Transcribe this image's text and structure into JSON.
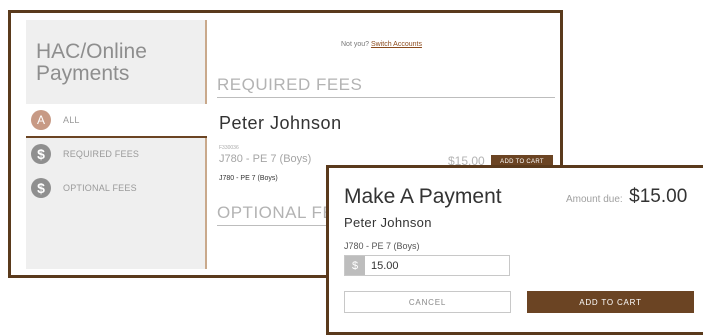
{
  "portal": {
    "title": "HAC/Online Payments",
    "nav": [
      {
        "icon": "A",
        "label": "ALL"
      },
      {
        "icon": "$",
        "label": "REQUIRED FEES"
      },
      {
        "icon": "$",
        "label": "OPTIONAL FEES"
      }
    ],
    "not_you_text": "Not you?",
    "switch_accounts_link": "Switch Accounts",
    "required_heading": "REQUIRED FEES",
    "optional_heading": "OPTIONAL FEES",
    "student_name": "Peter Johnson",
    "fee": {
      "id": "F330036",
      "name": "J780 - PE 7 (Boys)",
      "sub": "J780 - PE 7 (Boys)",
      "amount": "$15.00",
      "add_label": "ADD TO CART"
    }
  },
  "modal": {
    "title": "Make A Payment",
    "amount_due_label": "Amount due:",
    "amount_due_value": "$15.00",
    "student_name": "Peter Johnson",
    "fee_name": "J780 - PE 7 (Boys)",
    "currency_symbol": "$",
    "amount_value": "15.00",
    "cancel_label": "CANCEL",
    "add_label": "ADD TO CART"
  },
  "colors": {
    "accent_brown": "#6b4423",
    "frame_brown": "#5a3a1c"
  }
}
